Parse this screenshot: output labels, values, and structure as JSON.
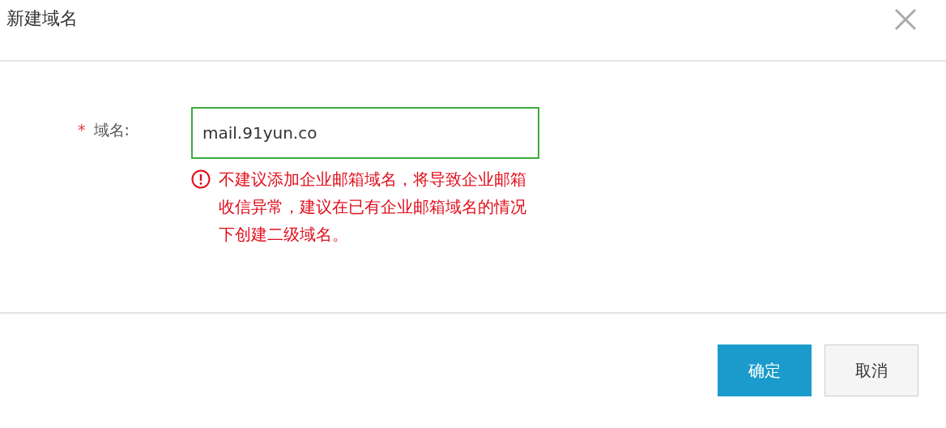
{
  "dialog": {
    "title": "新建域名"
  },
  "field": {
    "label": "域名:",
    "required": true,
    "required_mark": "*",
    "value": "mail.91yun.co",
    "warning": "不建议添加企业邮箱域名，将导致企业邮箱收信异常，建议在已有企业邮箱域名的情况下创建二级域名。"
  },
  "buttons": [
    {
      "label": "确定",
      "kind": "primary"
    },
    {
      "label": "取消",
      "kind": "secondary"
    }
  ]
}
